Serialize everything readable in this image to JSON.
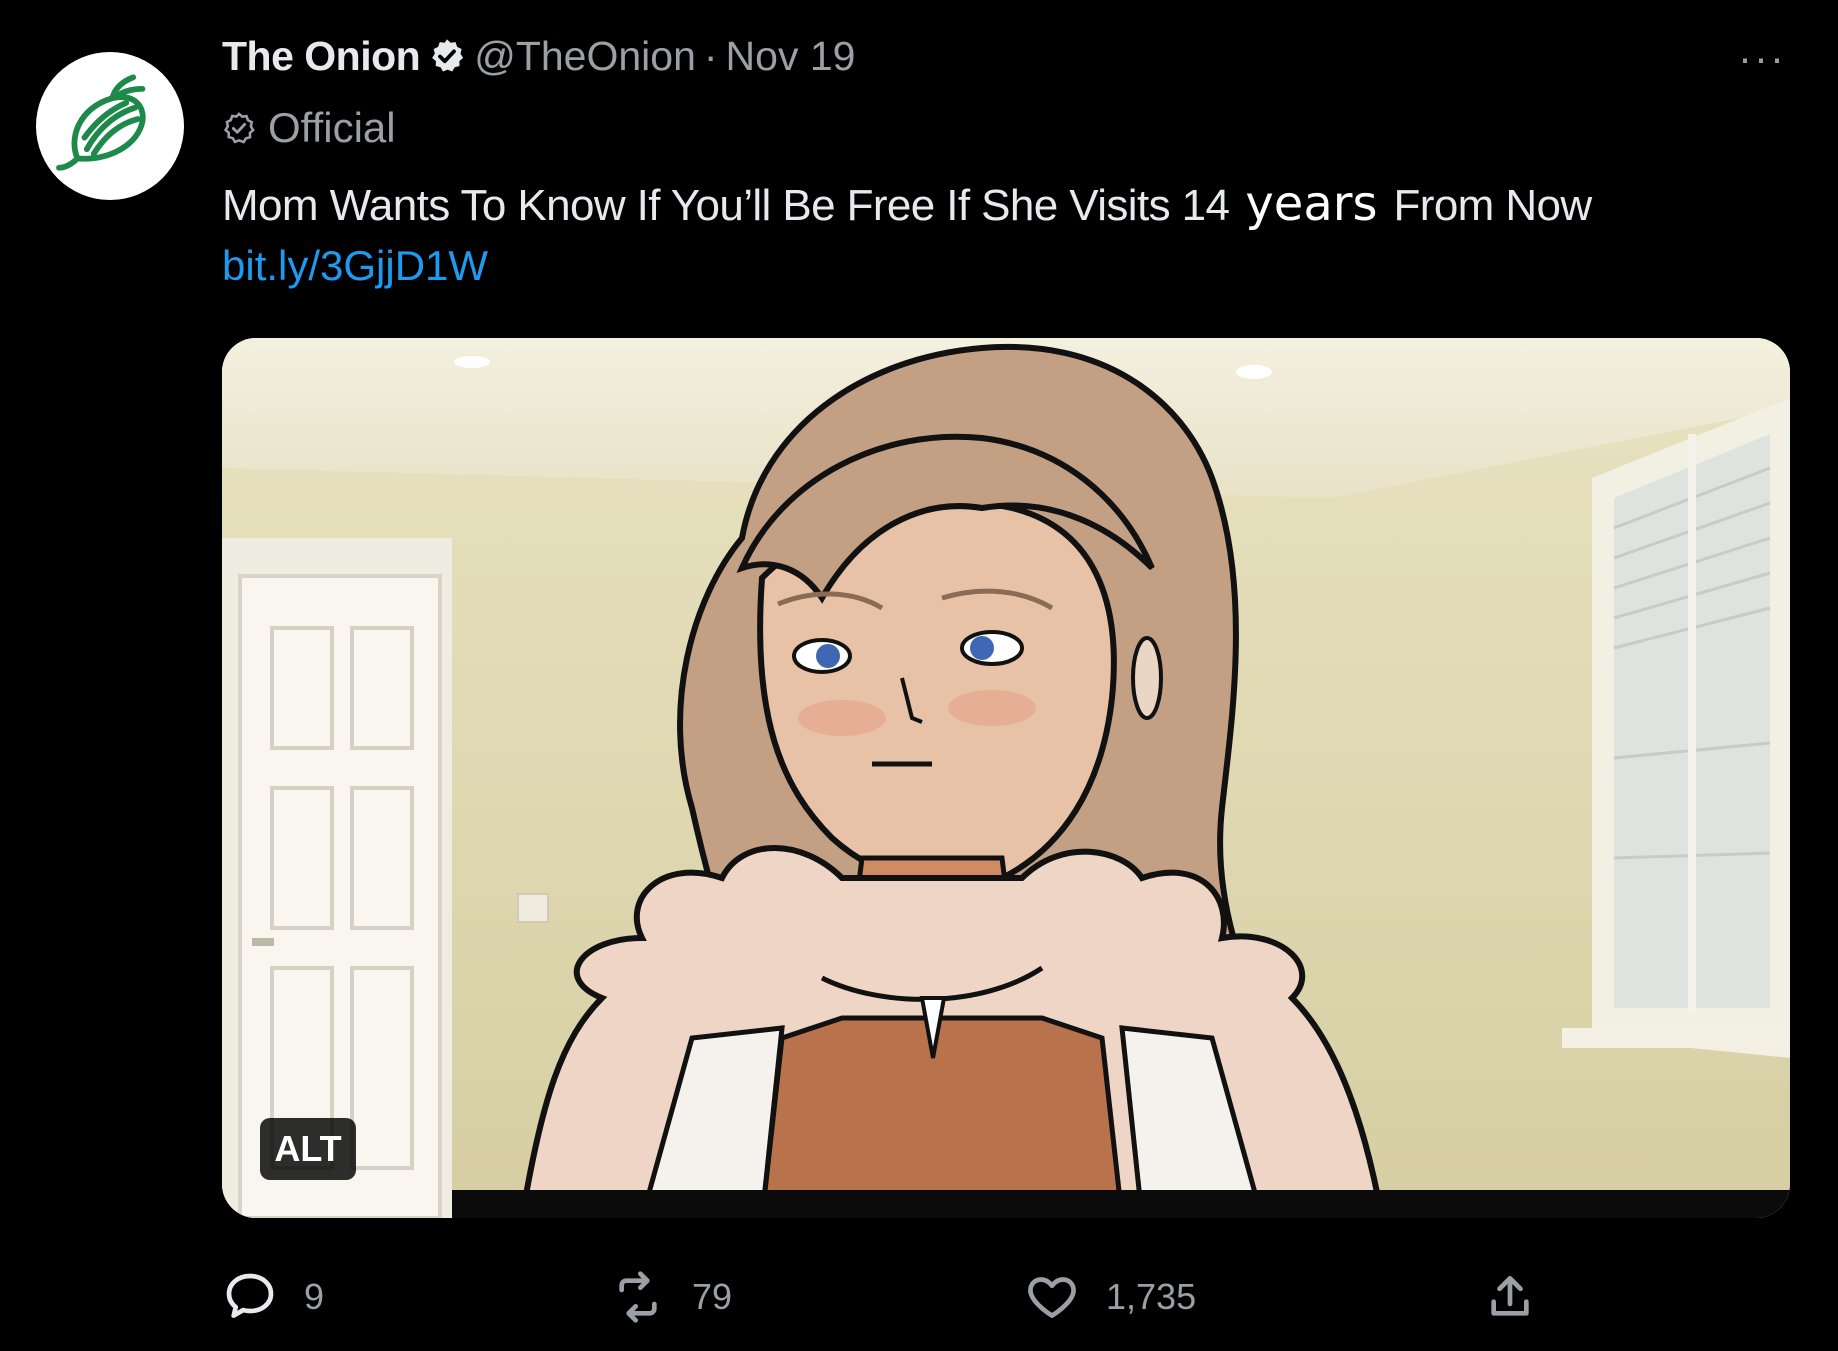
{
  "tweet": {
    "display_name": "The Onion",
    "handle": "@TheOnion",
    "separator": "·",
    "date": "Nov 19",
    "badge_label": "Official",
    "text_before": "Mom Wants To Know If You’ll Be Free If She Visits 14",
    "text_edited": "years",
    "text_after": "From Now",
    "link": "bit.ly/3GjjD1W",
    "more_label": "···",
    "alt_label": "ALT"
  },
  "actions": {
    "replies": "9",
    "retweets": "79",
    "likes": "1,735"
  },
  "colors": {
    "background": "#000000",
    "primary_text": "#e7e9ea",
    "secondary_text": "#9aa0a6",
    "link": "#1d9bf0",
    "onion_green": "#1e8a4a"
  },
  "icons": {
    "avatar": "onion-logo-icon",
    "verified": "verified-badge-icon",
    "official": "official-check-icon",
    "reply": "reply-icon",
    "retweet": "retweet-icon",
    "like": "heart-icon",
    "share": "share-icon"
  }
}
